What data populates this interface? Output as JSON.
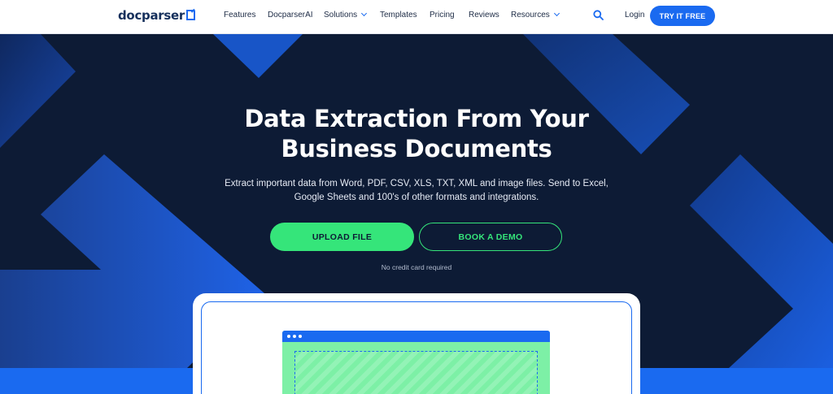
{
  "nav": {
    "logo_text": "docparser",
    "items": [
      {
        "label": "Features",
        "has_dropdown": false
      },
      {
        "label": "DocparserAI",
        "has_dropdown": false
      },
      {
        "label": "Solutions",
        "has_dropdown": true
      },
      {
        "label": "Templates",
        "has_dropdown": false
      },
      {
        "label": "Pricing",
        "has_dropdown": false
      },
      {
        "label": "Reviews",
        "has_dropdown": false
      },
      {
        "label": "Resources",
        "has_dropdown": true
      }
    ],
    "search_icon": "search-icon",
    "login_label": "Login",
    "cta_label": "TRY IT FREE"
  },
  "hero": {
    "title_line1": "Data Extraction From Your",
    "title_line2": "Business Documents",
    "subtitle_line1": "Extract important data from Word, PDF, CSV, XLS, TXT, XML and image files. Send to Excel,",
    "subtitle_line2": "Google Sheets and 100's of other formats and integrations.",
    "upload_label": "UPLOAD FILE",
    "demo_label": "BOOK A DEMO",
    "note": "No credit card required"
  },
  "colors": {
    "primary_blue": "#1a6af0",
    "dark_navy": "#0d1b35",
    "accent_green": "#35e57a",
    "white": "#ffffff"
  }
}
